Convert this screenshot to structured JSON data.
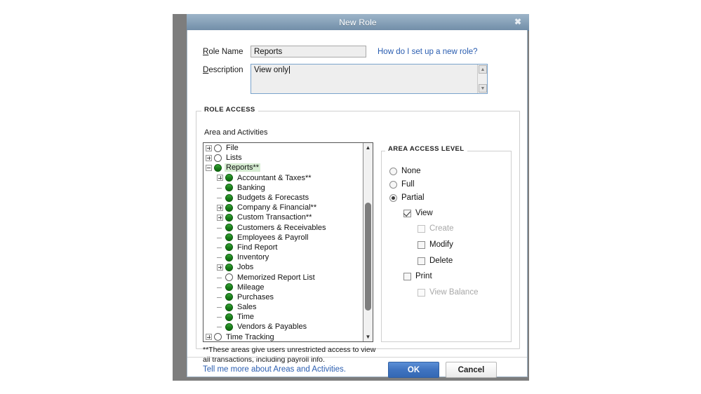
{
  "window": {
    "title": "New Role",
    "close_icon": "close-icon"
  },
  "form": {
    "role_name_label_pre": "R",
    "role_name_label_key": "o",
    "role_name_label": "Role Name",
    "role_name_value": "Reports",
    "role_name_placeholder": "",
    "help_link": "How do I set up a new role?",
    "description_label": "Description",
    "description_value": "View only",
    "description_placeholder": "",
    "scroll_up_icon": "triangle-up-icon",
    "scroll_down_icon": "triangle-down-icon"
  },
  "role_access": {
    "group_title": "ROLE ACCESS",
    "tree_header": "Area and Activities",
    "footnote": "**These areas give users unrestricted access to view all transactions, including payroll info.",
    "tree": [
      {
        "label": "File",
        "indent": 0,
        "expander": "collapsed",
        "access": "none"
      },
      {
        "label": "Lists",
        "indent": 0,
        "expander": "collapsed",
        "access": "none"
      },
      {
        "label": "Reports**",
        "indent": 0,
        "expander": "expanded",
        "access": "full",
        "selected": true
      },
      {
        "label": "Accountant & Taxes**",
        "indent": 1,
        "expander": "collapsed",
        "access": "full"
      },
      {
        "label": "Banking",
        "indent": 1,
        "expander": "leaf",
        "access": "full"
      },
      {
        "label": "Budgets & Forecasts",
        "indent": 1,
        "expander": "leaf",
        "access": "full"
      },
      {
        "label": "Company & Financial**",
        "indent": 1,
        "expander": "collapsed",
        "access": "full"
      },
      {
        "label": "Custom Transaction**",
        "indent": 1,
        "expander": "collapsed",
        "access": "full"
      },
      {
        "label": "Customers & Receivables",
        "indent": 1,
        "expander": "leaf",
        "access": "full"
      },
      {
        "label": "Employees & Payroll",
        "indent": 1,
        "expander": "leaf",
        "access": "full"
      },
      {
        "label": "Find Report",
        "indent": 1,
        "expander": "leaf",
        "access": "full"
      },
      {
        "label": "Inventory",
        "indent": 1,
        "expander": "leaf",
        "access": "full"
      },
      {
        "label": "Jobs",
        "indent": 1,
        "expander": "collapsed",
        "access": "full"
      },
      {
        "label": "Memorized Report List",
        "indent": 1,
        "expander": "leaf",
        "access": "none"
      },
      {
        "label": "Mileage",
        "indent": 1,
        "expander": "leaf",
        "access": "full"
      },
      {
        "label": "Purchases",
        "indent": 1,
        "expander": "leaf",
        "access": "full"
      },
      {
        "label": "Sales",
        "indent": 1,
        "expander": "leaf",
        "access": "full"
      },
      {
        "label": "Time",
        "indent": 1,
        "expander": "leaf",
        "access": "full"
      },
      {
        "label": "Vendors & Payables",
        "indent": 1,
        "expander": "leaf",
        "access": "full"
      },
      {
        "label": "Time Tracking",
        "indent": 0,
        "expander": "collapsed",
        "access": "none"
      }
    ],
    "scrollbar": {
      "up_icon": "triangle-up-icon",
      "down_icon": "triangle-down-icon",
      "thumb_top_pct": 28,
      "thumb_height_pct": 60
    }
  },
  "area_access_level": {
    "group_title": "AREA ACCESS LEVEL",
    "options": [
      {
        "label": "None",
        "type": "radio",
        "checked": false,
        "disabled": false,
        "indent": 0
      },
      {
        "label": "Full",
        "type": "radio",
        "checked": false,
        "disabled": false,
        "indent": 0
      },
      {
        "label": "Partial",
        "type": "radio",
        "checked": true,
        "disabled": false,
        "indent": 0
      },
      {
        "label": "View",
        "type": "checkbox",
        "checked": true,
        "disabled": false,
        "indent": 1
      },
      {
        "label": "Create",
        "type": "checkbox",
        "checked": false,
        "disabled": true,
        "indent": 2
      },
      {
        "label": "Modify",
        "type": "checkbox",
        "checked": false,
        "disabled": false,
        "indent": 2
      },
      {
        "label": "Delete",
        "type": "checkbox",
        "checked": false,
        "disabled": false,
        "indent": 2
      },
      {
        "label": "Print",
        "type": "checkbox",
        "checked": false,
        "disabled": false,
        "indent": 1
      },
      {
        "label": "View Balance",
        "type": "checkbox",
        "checked": false,
        "disabled": true,
        "indent": 2
      }
    ]
  },
  "footer": {
    "tell_link": "Tell me more about Areas and Activities.",
    "ok_label": "OK",
    "cancel_label": "Cancel"
  },
  "colors": {
    "titlebar_top": "#9db4c8",
    "titlebar_bottom": "#728ea8",
    "link": "#2a5db0",
    "ok_button": "#3f73c0",
    "tree_full": "#1a7d1a",
    "selection": "#d6ecd2",
    "frame": "#7d7d7d"
  }
}
